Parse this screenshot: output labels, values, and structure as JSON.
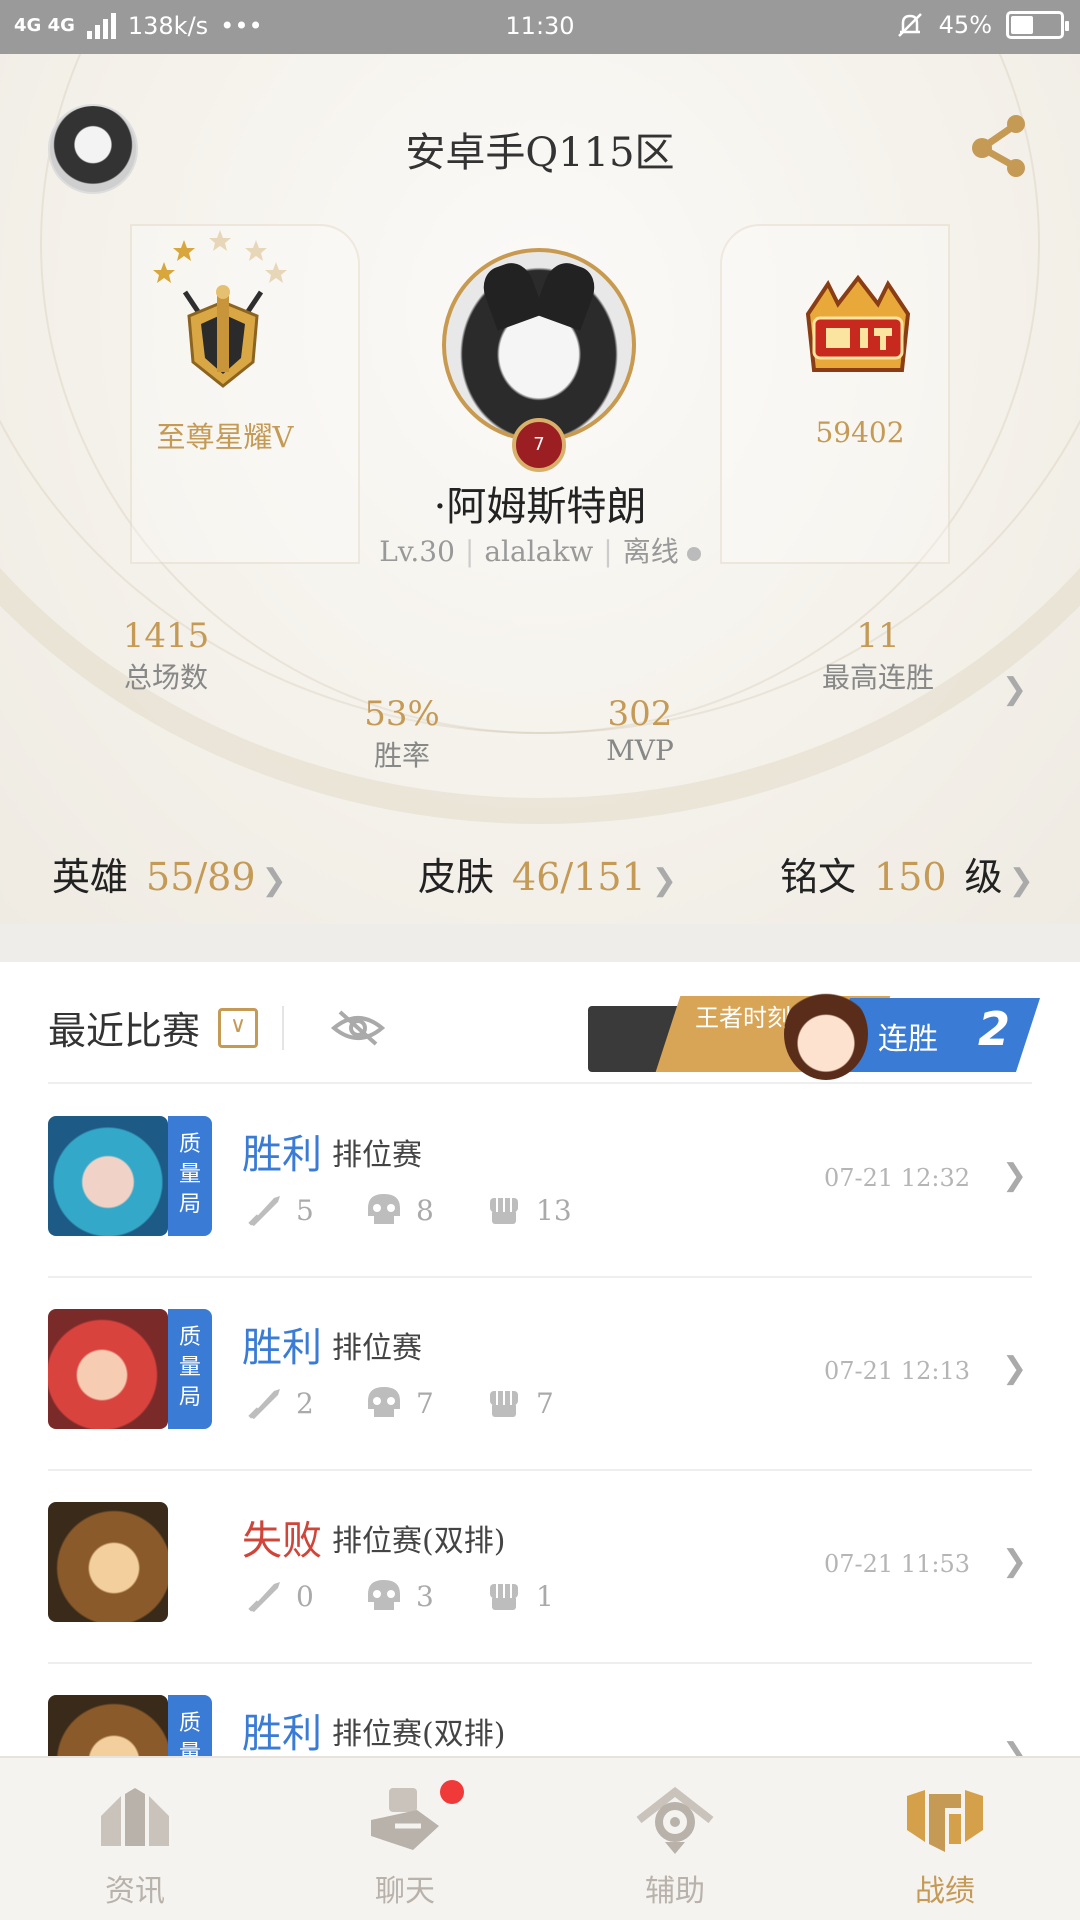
{
  "status_bar": {
    "network": "4G 4G",
    "speed": "138k/s",
    "more": "•••",
    "time": "11:30",
    "battery": "45%",
    "battery_level": 0.45
  },
  "profile": {
    "server": "安卓手Q115区",
    "rank_name": "至尊星耀V",
    "rank_stars": 5,
    "festival_score": "59402",
    "hero_level_badge": "7",
    "player_name": "·阿姆斯特朗",
    "level": "Lv.30",
    "account": "alalakw",
    "online_status": "离线",
    "stats": {
      "total_games": "1415",
      "total_games_label": "总场数",
      "win_rate": "53%",
      "win_rate_label": "胜率",
      "mvp": "302",
      "mvp_label": "MVP",
      "best_streak": "11",
      "best_streak_label": "最高连胜"
    },
    "collections": {
      "heroes_label": "英雄",
      "heroes_owned": "55",
      "heroes_total": "/89",
      "skins_label": "皮肤",
      "skins_owned": "46",
      "skins_total": "/151",
      "runes_label": "铭文",
      "runes_level": "150",
      "runes_unit": "级"
    }
  },
  "recent_matches": {
    "title": "最近比赛",
    "promo": {
      "moment_label": "王者时刻",
      "streak_label": "连胜",
      "streak_count": "2"
    },
    "quality_label": "质量局",
    "items": [
      {
        "result": "胜利",
        "mode": "排位赛",
        "kills": "5",
        "deaths": "8",
        "assists": "13",
        "time": "07-21 12:32",
        "quality": true
      },
      {
        "result": "胜利",
        "mode": "排位赛",
        "kills": "2",
        "deaths": "7",
        "assists": "7",
        "time": "07-21 12:13",
        "quality": true
      },
      {
        "result": "失败",
        "mode": "排位赛(双排)",
        "kills": "0",
        "deaths": "3",
        "assists": "1",
        "time": "07-21 11:53",
        "quality": false
      },
      {
        "result": "胜利",
        "mode": "排位赛(双排)",
        "kills": "",
        "deaths": "",
        "assists": "",
        "time": "",
        "quality": true
      }
    ]
  },
  "bottom_nav": [
    {
      "label": "资讯",
      "icon": "news-icon"
    },
    {
      "label": "聊天",
      "icon": "chat-icon",
      "badge": true
    },
    {
      "label": "辅助",
      "icon": "assist-icon"
    },
    {
      "label": "战绩",
      "icon": "record-icon",
      "active": true
    }
  ],
  "colors": {
    "gold": "#c49a55",
    "win_blue": "#3a7bd5",
    "lose_red": "#d0453a",
    "status_bar": "#9a9a9a",
    "badge_red": "#f03a3a"
  }
}
